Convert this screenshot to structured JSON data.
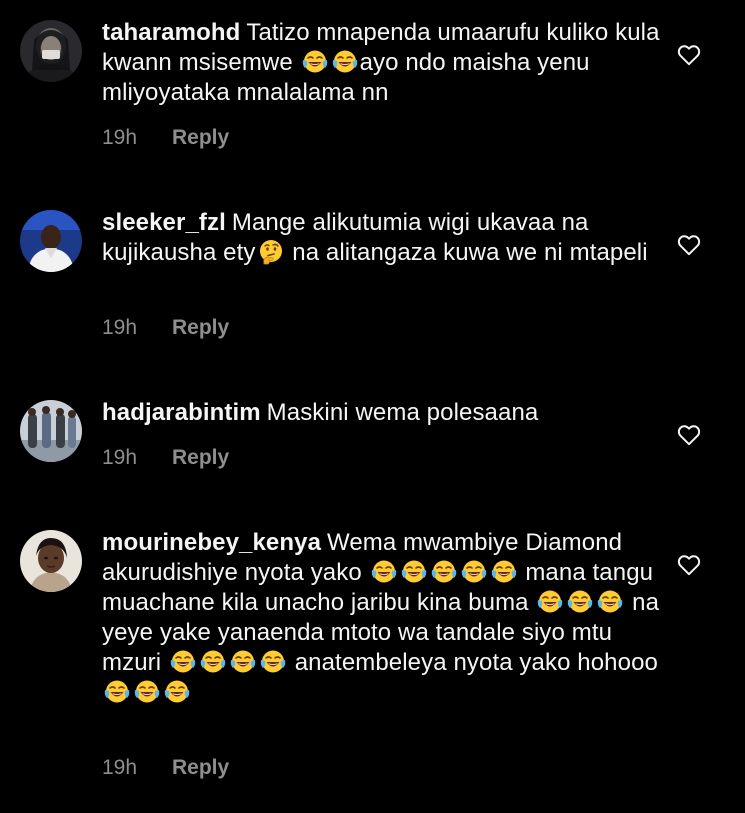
{
  "comments": [
    {
      "username": "taharamohd",
      "segments": [
        {
          "t": "Tatizo mnapenda umaarufu kuliko kula kwann msisemwe "
        },
        {
          "e": "face-with-tears-of-joy-emoji"
        },
        {
          "e": "face-with-tears-of-joy-emoji"
        },
        {
          "t": "ayo ndo maisha yenu mliyoyataka  mnalalama nn"
        }
      ],
      "time": "19h",
      "reply": "Reply",
      "like_icon": "heart-icon"
    },
    {
      "username": "sleeker_fzl",
      "segments": [
        {
          "t": "Mange alikutumia wigi ukavaa na kujikausha ety"
        },
        {
          "e": "thinking-face-emoji"
        },
        {
          "t": " na alitangaza kuwa we ni mtapeli"
        }
      ],
      "time": "19h",
      "reply": "Reply",
      "like_icon": "heart-icon"
    },
    {
      "username": "hadjarabintim",
      "segments": [
        {
          "t": "Maskini wema polesaana"
        }
      ],
      "time": "19h",
      "reply": "Reply",
      "like_icon": "heart-icon"
    },
    {
      "username": "mourinebey_kenya",
      "segments": [
        {
          "t": "Wema mwambiye Diamond akurudishiye nyota yako "
        },
        {
          "e": "face-with-tears-of-joy-emoji"
        },
        {
          "e": "face-with-tears-of-joy-emoji"
        },
        {
          "e": "face-with-tears-of-joy-emoji"
        },
        {
          "e": "face-with-tears-of-joy-emoji"
        },
        {
          "e": "face-with-tears-of-joy-emoji"
        },
        {
          "t": " mana tangu muachane kila unacho jaribu kina buma "
        },
        {
          "e": "face-with-tears-of-joy-emoji"
        },
        {
          "e": "face-with-tears-of-joy-emoji"
        },
        {
          "e": "face-with-tears-of-joy-emoji"
        },
        {
          "t": " na yeye yake yanaenda mtoto wa tandale siyo mtu mzuri "
        },
        {
          "e": "face-with-tears-of-joy-emoji"
        },
        {
          "e": "face-with-tears-of-joy-emoji"
        },
        {
          "e": "face-with-tears-of-joy-emoji"
        },
        {
          "e": "face-with-tears-of-joy-emoji"
        },
        {
          "t": " anatembeleya nyota yako hohooo "
        },
        {
          "e": "face-with-tears-of-joy-emoji"
        },
        {
          "e": "face-with-tears-of-joy-emoji"
        },
        {
          "e": "face-with-tears-of-joy-emoji"
        }
      ],
      "time": "19h",
      "reply": "Reply",
      "like_icon": "heart-icon"
    }
  ],
  "colors": {
    "background": "#000000",
    "text": "#f5f5f5",
    "secondary_text": "#8e8e8e"
  }
}
